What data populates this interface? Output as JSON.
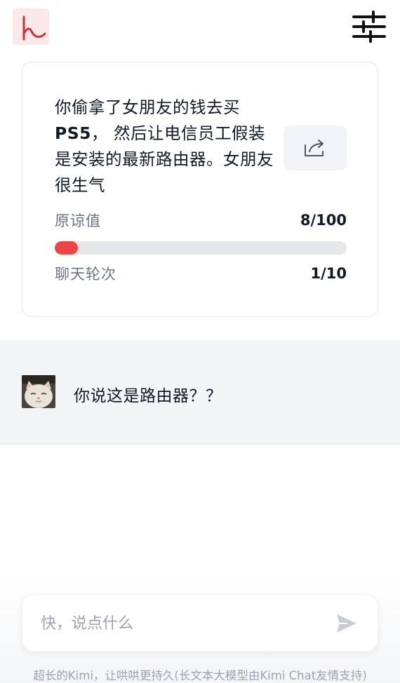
{
  "app": {
    "logo_icon": "kimi-logo-icon",
    "settings_icon": "sliders-icon"
  },
  "scenario": {
    "text_part1": "你偷拿了女朋友的钱去买",
    "text_bold": "PS5",
    "text_part2": "， 然后让电信员工假装是安装的最新路由器。女朋友很生气",
    "share_icon": "share-icon"
  },
  "stats": {
    "forgiveness_label": "原谅值",
    "forgiveness_value": "8/100",
    "forgiveness_fraction": 0.08,
    "rounds_label": "聊天轮次",
    "rounds_value": "1/10",
    "accent_color": "#ef4444"
  },
  "messages": [
    {
      "avatar": "cat-avatar",
      "text": "你说这是路由器？？"
    }
  ],
  "composer": {
    "placeholder": "快，说点什么",
    "send_icon": "send-icon"
  },
  "footer": {
    "note": "超长的Kimi，让哄哄更持久(长文本大模型由Kimi Chat友情支持)"
  }
}
